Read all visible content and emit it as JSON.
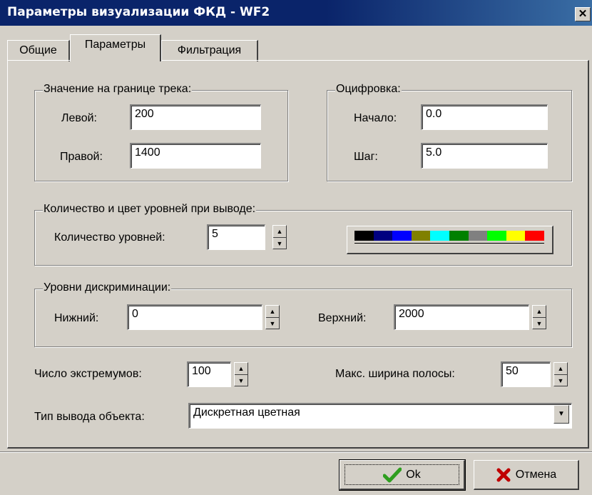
{
  "window": {
    "title": "Параметры визуализации ФКД - WF2",
    "close_glyph": "✕"
  },
  "tabs": [
    {
      "label": "Общие"
    },
    {
      "label": "Параметры"
    },
    {
      "label": "Фильтрация"
    }
  ],
  "track_bounds": {
    "legend": "Значение на границе трека:",
    "left_label": "Левой:",
    "left_value": "200",
    "right_label": "Правой:",
    "right_value": "1400"
  },
  "digitization": {
    "legend": "Оцифровка:",
    "start_label": "Начало:",
    "start_value": "0.0",
    "step_label": "Шаг:",
    "step_value": "5.0"
  },
  "levels": {
    "legend": "Количество и цвет уровней при выводе:",
    "count_label": "Количество уровней:",
    "count_value": "5",
    "palette": [
      "#000000",
      "#000080",
      "#0000ff",
      "#808000",
      "#00ffff",
      "#008000",
      "#808080",
      "#00ff00",
      "#ffff00",
      "#ff0000"
    ]
  },
  "discrimination": {
    "legend": "Уровни дискриминации:",
    "lower_label": "Нижний:",
    "lower_value": "0",
    "upper_label": "Верхний:",
    "upper_value": "2000"
  },
  "extrema": {
    "label": "Число экстремумов:",
    "value": "100"
  },
  "max_width": {
    "label": "Макс. ширина полосы:",
    "value": "50"
  },
  "output_type": {
    "label": "Тип вывода объекта:",
    "value": "Дискретная цветная"
  },
  "buttons": {
    "ok_label": "Ok",
    "cancel_label": "Отмена"
  },
  "icons": {
    "ok": "check-icon",
    "cancel": "x-icon",
    "spin_up": "▲",
    "spin_down": "▼",
    "combo": "▼"
  },
  "colors": {
    "title_bar": "#0a246a",
    "face": "#d4d0c8",
    "ok_icon": "#2e9e1f",
    "cancel_icon": "#c00000"
  }
}
